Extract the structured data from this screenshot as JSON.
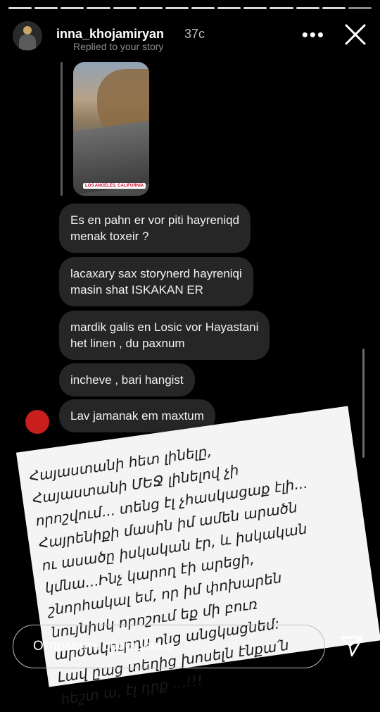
{
  "progress": {
    "segments": 14,
    "active_index": 13
  },
  "header": {
    "username": "inna_khojamiryan",
    "time": "37c",
    "subtitle": "Replied to your story",
    "more_icon": "more-horizontal-icon",
    "close_icon": "close-icon"
  },
  "story_thumbnail": {
    "location_label": "LOS ANGELES, CALIFORNIA"
  },
  "messages": [
    {
      "text": "Es en pahn er vor piti hayreniqd\nmenak toxeir ?"
    },
    {
      "text": "lacaxary sax storynerd hayreniqi\nmasin shat ISKAKAN ER"
    },
    {
      "text": "mardik galis en Losic vor Hayastani\nhet linen , du paxnum"
    },
    {
      "text": "incheve , bari hangist"
    },
    {
      "text": "Lav jamanak em maxtum"
    }
  ],
  "note": {
    "text": "Հայաստանի հետ լինելը,\nՀայաստանի ՄԵՋ լինելով չի\nորոշվում... տենց էլ չհասկացաք էլի...\nՀայրենիքի մասին իմ ամեն արածն\nու ասածը իսկական էր, և իսկական\nկմնա...Ինչ կարող էի արեցի,\nշնորհակալ եմ, որ իմ փոխարեն\nնույնիսկ որոշում եք մի բուռ\nարժակուրդս ոնց անցկացնեմ:\nԼավ ըաց տեղից խոսելն էնքա՛ն\nհեշտ ա, էլ դրք ...!!!"
  },
  "composer": {
    "placeholder": "Отправить сообщение",
    "send_icon": "send-icon"
  }
}
